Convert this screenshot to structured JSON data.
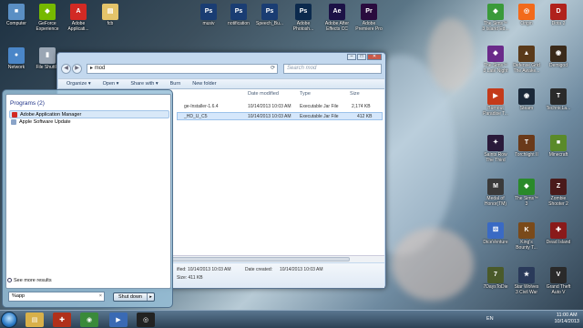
{
  "desktop_left": [
    {
      "label": "Computer",
      "icon": "computer-icon",
      "color": "#5a8fc4",
      "glyph": "■"
    },
    {
      "label": "GeForce Experience",
      "icon": "geforce-icon",
      "color": "#76b900",
      "glyph": "◆"
    },
    {
      "label": "Adobe Applicati...",
      "icon": "adobe-icon",
      "color": "#d22a24",
      "glyph": "A"
    },
    {
      "label": "fcb",
      "icon": "folder-icon",
      "color": "#e4c46a",
      "glyph": "▤"
    },
    {
      "label": "Network",
      "icon": "network-icon",
      "color": "#4a86c8",
      "glyph": "●"
    },
    {
      "label": "File Shuttle",
      "icon": "file-shuttle-icon",
      "color": "#9aa6b4",
      "glyph": "▮"
    }
  ],
  "desktop_top": [
    {
      "label": "musiv",
      "icon": "psd-file-icon",
      "color": "#1a3d73",
      "glyph": "Ps"
    },
    {
      "label": "notification",
      "icon": "psd-file-icon",
      "color": "#1a3d73",
      "glyph": "Ps"
    },
    {
      "label": "Speech_Bu...",
      "icon": "psd-file-icon",
      "color": "#1a3d73",
      "glyph": "Ps"
    },
    {
      "label": "Adobe Photosh...",
      "icon": "photoshop-icon",
      "color": "#0c2a4d",
      "glyph": "Ps"
    },
    {
      "label": "Adobe After Effects CC",
      "icon": "after-effects-icon",
      "color": "#1c1246",
      "glyph": "Ae"
    },
    {
      "label": "Adobe Premiere Pro",
      "icon": "premiere-icon",
      "color": "#2a0c3e",
      "glyph": "Pr"
    }
  ],
  "desktop_right": [
    {
      "label": "The Sims™ 3 Island Ed...",
      "icon": "sims-icon",
      "color": "#3a9a3a",
      "glyph": "◆"
    },
    {
      "label": "Origin",
      "icon": "origin-icon",
      "color": "#f26a1b",
      "glyph": "◎"
    },
    {
      "label": "Dota 2",
      "icon": "dota-icon",
      "color": "#b0221c",
      "glyph": "D"
    },
    {
      "label": "The Sims™ 3 Late Night",
      "icon": "sims-icon",
      "color": "#6a2a8a",
      "glyph": "◆"
    },
    {
      "label": "Defense Grid The Awake...",
      "icon": "defense-grid-icon",
      "color": "#5a3a1a",
      "glyph": "▲"
    },
    {
      "label": "Demigod",
      "icon": "demigod-icon",
      "color": "#3a2a1a",
      "glyph": "◉"
    },
    {
      "label": "Burnout Paradise T...",
      "icon": "burnout-icon",
      "color": "#c43a1a",
      "glyph": "▶"
    },
    {
      "label": "Steam",
      "icon": "steam-icon",
      "color": "#1b2838",
      "glyph": "◉"
    },
    {
      "label": "TechnicLa...",
      "icon": "techniclauncher-icon",
      "color": "#2a2a2a",
      "glyph": "T"
    },
    {
      "label": "Saints Row The Third",
      "icon": "saints-row-icon",
      "color": "#2a1a3a",
      "glyph": "✦"
    },
    {
      "label": "Torchlight II",
      "icon": "torchlight-icon",
      "color": "#6a3a1a",
      "glyph": "T"
    },
    {
      "label": "Minecraft",
      "icon": "minecraft-icon",
      "color": "#5a8a2a",
      "glyph": "■"
    },
    {
      "label": "Medal of Honor(TM)",
      "icon": "medal-of-honor-icon",
      "color": "#3a3a3a",
      "glyph": "M"
    },
    {
      "label": "The Sims™ 3",
      "icon": "sims-icon",
      "color": "#2a8a2a",
      "glyph": "◆"
    },
    {
      "label": "Zombie Shooter 2",
      "icon": "zombie-shooter-icon",
      "color": "#4a1a1a",
      "glyph": "Z"
    },
    {
      "label": "DiceVenture",
      "icon": "diceventure-icon",
      "color": "#3a6ac4",
      "glyph": "⚄"
    },
    {
      "label": "King's Bounty T...",
      "icon": "kings-bounty-icon",
      "color": "#7a4a1a",
      "glyph": "K"
    },
    {
      "label": "Dead Island",
      "icon": "dead-island-icon",
      "color": "#8a1a1a",
      "glyph": "✚"
    },
    {
      "label": "7DaysToDie",
      "icon": "7days-icon",
      "color": "#4a5a2a",
      "glyph": "7"
    },
    {
      "label": "Star Wolves 3 Civil War",
      "icon": "star-wolves-icon",
      "color": "#2a3a5a",
      "glyph": "★"
    },
    {
      "label": "Grand Theft Auto V",
      "icon": "gta-icon",
      "color": "#2a2a2a",
      "glyph": "V"
    }
  ],
  "explorer": {
    "address": "mod",
    "search_placeholder": "Search mod",
    "toolbar": [
      "Organize ▾",
      "Open ▾",
      "Share with ▾",
      "Burn",
      "New folder"
    ],
    "columns": [
      "Date modified",
      "Type",
      "Size"
    ],
    "rows": [
      {
        "name": "ge-Installer-1.6.4",
        "date": "10/14/2013 10:03 AM",
        "type": "Executable Jar File",
        "size": "2,174 KB"
      },
      {
        "name": "_HD_U_C5",
        "date": "10/14/2013 10:03 AM",
        "type": "Executable Jar File",
        "size": "412 KB"
      }
    ],
    "details": {
      "modified": "ified: 10/14/2013 10:03 AM",
      "created_label": "Date created:",
      "created": "10/14/2013 10:03 AM",
      "size": "Size: 411 KB"
    }
  },
  "start_menu": {
    "header": "Programs (2)",
    "items": [
      {
        "label": "Adobe Application Manager",
        "selected": true,
        "color": "#d22a24"
      },
      {
        "label": "Apple Software Update",
        "selected": false,
        "color": "#8aa4c8"
      }
    ],
    "see_more": "See more results",
    "search_value": "%app",
    "clear": "×",
    "shutdown": "Shut down",
    "shutdown_arrow": "▸"
  },
  "taskbar": {
    "apps": [
      {
        "icon": "explorer-folder-icon",
        "color": "#d8b04a",
        "glyph": "▤"
      },
      {
        "icon": "puzzle-icon",
        "color": "#b0301a",
        "glyph": "✚"
      },
      {
        "icon": "chrome-icon",
        "color": "#3a8a3a",
        "glyph": "◉"
      },
      {
        "icon": "media-player-icon",
        "color": "#3a6ab4",
        "glyph": "▶"
      },
      {
        "icon": "obs-icon",
        "color": "#222222",
        "glyph": "◎"
      }
    ],
    "language": "EN",
    "time": "11:00 AM",
    "date": "10/14/2013"
  }
}
